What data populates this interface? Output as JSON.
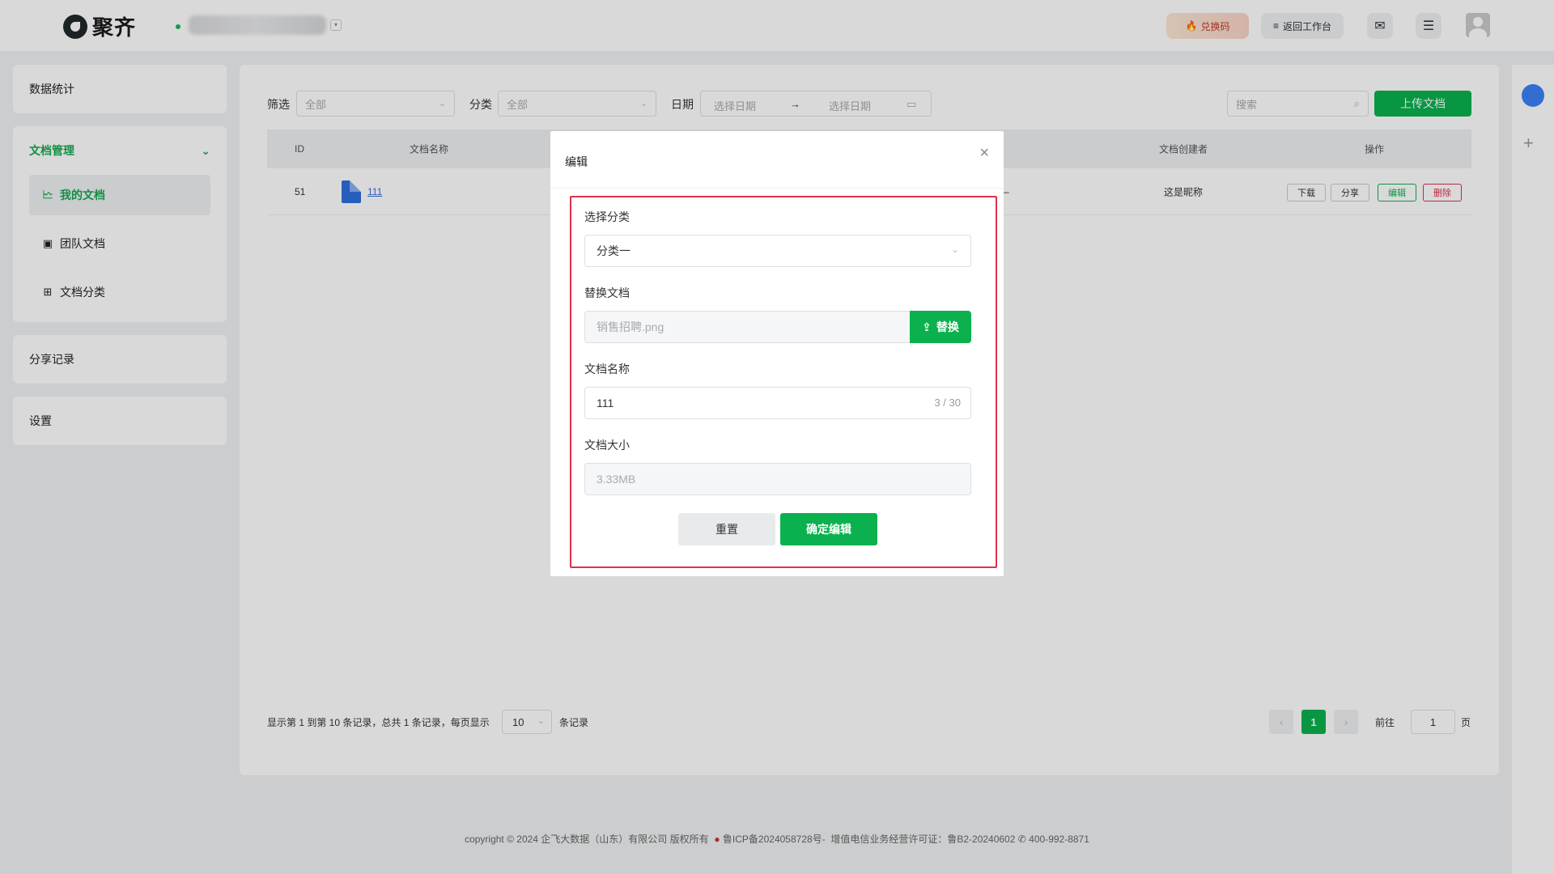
{
  "header": {
    "logo_text": "聚齐",
    "redeem_label": "兑换码",
    "back_label": "返回工作台"
  },
  "sidebar": {
    "stats": "数据统计",
    "docs_group": "文档管理",
    "my_docs": "我的文档",
    "team_docs": "团队文档",
    "doc_category": "文档分类",
    "share_records": "分享记录",
    "settings": "设置"
  },
  "filters": {
    "filter_label": "筛选",
    "filter_value": "全部",
    "category_label": "分类",
    "category_value": "全部",
    "date_label": "日期",
    "date_start": "选择日期",
    "date_arrow": "→",
    "date_end": "选择日期",
    "search_placeholder": "搜索",
    "upload_label": "上传文档"
  },
  "table": {
    "headers": {
      "id": "ID",
      "name": "文档名称",
      "creator": "文档创建者",
      "actions": "操作"
    },
    "rows": [
      {
        "id": "51",
        "name": "111",
        "dash": "–",
        "creator": "这是昵称"
      }
    ],
    "actions": {
      "download": "下载",
      "share": "分享",
      "edit": "编辑",
      "delete": "删除"
    }
  },
  "pagination": {
    "info": "显示第 1 到第 10 条记录，总共 1 条记录，每页显示",
    "page_size": "10",
    "suffix": "条记录",
    "prev": "‹",
    "current": "1",
    "next": "›",
    "goto_label": "前往",
    "goto_value": "1",
    "page_unit": "页"
  },
  "footer": {
    "text": "copyright © 2024 企飞大数据（山东）有限公司 版权所有",
    "icp": "鲁ICP备2024058728号-",
    "license": "增值电信业务经营许可证：鲁B2-20240602",
    "phone": "400-992-8871"
  },
  "dialog": {
    "title": "编辑",
    "close": "×",
    "category_label": "选择分类",
    "category_value": "分类一",
    "replace_label": "替换文档",
    "replace_file": "销售招聘.png",
    "replace_button": "替换",
    "name_label": "文档名称",
    "name_value": "111",
    "name_counter": "3 / 30",
    "size_label": "文档大小",
    "size_value": "3.33MB",
    "reset_button": "重置",
    "confirm_button": "确定编辑"
  },
  "colors": {
    "accent": "#0bb14e",
    "danger": "#e0304a",
    "link": "#3a6fd8"
  }
}
